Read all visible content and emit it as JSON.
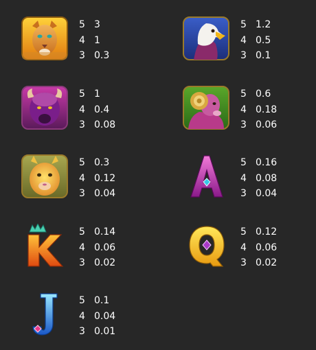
{
  "paytable": [
    {
      "symbol": "cougar-icon",
      "pays": [
        {
          "count": "5",
          "value": "3"
        },
        {
          "count": "4",
          "value": "1"
        },
        {
          "count": "3",
          "value": "0.3"
        }
      ]
    },
    {
      "symbol": "eagle-icon",
      "pays": [
        {
          "count": "5",
          "value": "1.2"
        },
        {
          "count": "4",
          "value": "0.5"
        },
        {
          "count": "3",
          "value": "0.1"
        }
      ]
    },
    {
      "symbol": "bison-icon",
      "pays": [
        {
          "count": "5",
          "value": "1"
        },
        {
          "count": "4",
          "value": "0.4"
        },
        {
          "count": "3",
          "value": "0.08"
        }
      ]
    },
    {
      "symbol": "ram-icon",
      "pays": [
        {
          "count": "5",
          "value": "0.6"
        },
        {
          "count": "4",
          "value": "0.18"
        },
        {
          "count": "3",
          "value": "0.06"
        }
      ]
    },
    {
      "symbol": "llama-icon",
      "pays": [
        {
          "count": "5",
          "value": "0.3"
        },
        {
          "count": "4",
          "value": "0.12"
        },
        {
          "count": "3",
          "value": "0.04"
        }
      ]
    },
    {
      "symbol": "letter-a-icon",
      "pays": [
        {
          "count": "5",
          "value": "0.16"
        },
        {
          "count": "4",
          "value": "0.08"
        },
        {
          "count": "3",
          "value": "0.04"
        }
      ]
    },
    {
      "symbol": "letter-k-icon",
      "pays": [
        {
          "count": "5",
          "value": "0.14"
        },
        {
          "count": "4",
          "value": "0.06"
        },
        {
          "count": "3",
          "value": "0.02"
        }
      ]
    },
    {
      "symbol": "letter-q-icon",
      "pays": [
        {
          "count": "5",
          "value": "0.12"
        },
        {
          "count": "4",
          "value": "0.06"
        },
        {
          "count": "3",
          "value": "0.02"
        }
      ]
    },
    {
      "symbol": "letter-j-icon",
      "pays": [
        {
          "count": "5",
          "value": "0.1"
        },
        {
          "count": "4",
          "value": "0.04"
        },
        {
          "count": "3",
          "value": "0.01"
        }
      ]
    }
  ],
  "colors": {
    "background": "#272727",
    "text": "#ffffff"
  }
}
